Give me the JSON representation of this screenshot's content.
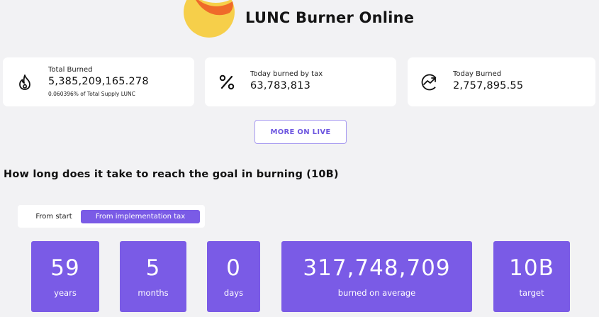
{
  "header": {
    "title": "LUNC Burner Online",
    "logo": "lunc-logo"
  },
  "cards": [
    {
      "icon": "flame-icon",
      "label": "Total Burned",
      "value": "5,385,209,165.278",
      "sub": "0.060396% of Total Supply LUNC"
    },
    {
      "icon": "percent-icon",
      "label": "Today burned by tax",
      "value": "63,783,813"
    },
    {
      "icon": "trending-up-icon",
      "label": "Today Burned",
      "value": "2,757,895.55"
    }
  ],
  "more_button": "MORE ON LIVE",
  "goal": {
    "heading": "How long does it take to reach the goal in burning (10B)",
    "tabs": [
      "From start",
      "From implementation tax"
    ],
    "active_tab": "From implementation tax",
    "stats": [
      {
        "value": "59",
        "label": "years"
      },
      {
        "value": "5",
        "label": "months"
      },
      {
        "value": "0",
        "label": "days"
      },
      {
        "value": "317,748,709",
        "label": "burned on average"
      },
      {
        "value": "10B",
        "label": "target"
      }
    ]
  },
  "colors": {
    "accent": "#7a5be6",
    "button_text": "#6e57e0",
    "logo_yellow": "#f6cf4a",
    "logo_orange": "#ef6a2a",
    "background": "#f2f2f4"
  }
}
